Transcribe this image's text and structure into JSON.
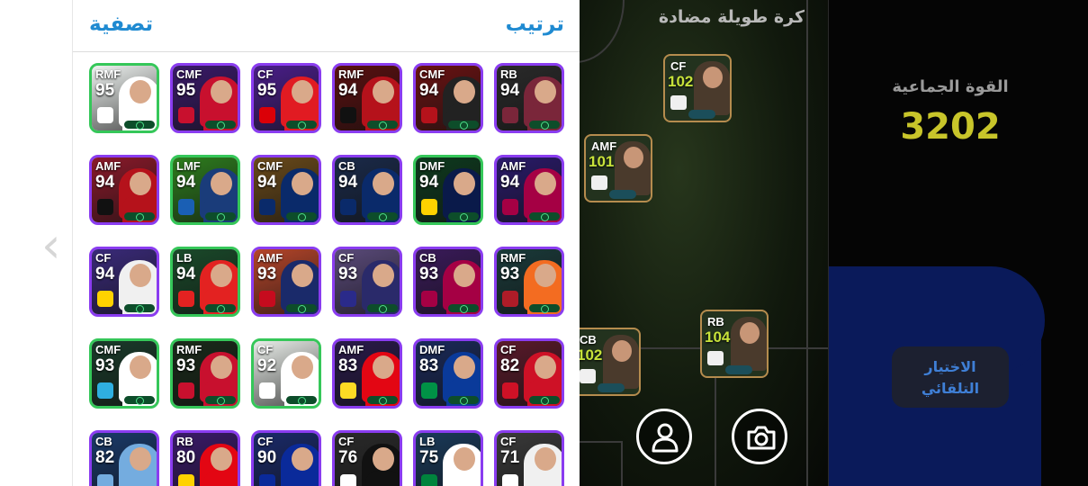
{
  "panel": {
    "filter_label": "تصفية",
    "sort_label": "ترتيب"
  },
  "cards": [
    {
      "pos": "RMF",
      "rating": "95",
      "border": "#35c759",
      "bg": "#eef2f0",
      "kit": "#ffffff",
      "crest": "#ffffff"
    },
    {
      "pos": "CMF",
      "rating": "95",
      "border": "#8a3cf0",
      "bg": "#3a1a6a",
      "kit": "#c8102e",
      "crest": "#c8102e"
    },
    {
      "pos": "CF",
      "rating": "95",
      "border": "#8a3cf0",
      "bg": "#4a1e8a",
      "kit": "#e11b22",
      "crest": "#db0007"
    },
    {
      "pos": "RMF",
      "rating": "94",
      "border": "#8a3cf0",
      "bg": "#5a1010",
      "kit": "#b5121b",
      "crest": "#111111"
    },
    {
      "pos": "CMF",
      "rating": "94",
      "border": "#8a3cf0",
      "bg": "#6a1212",
      "kit": "#222222",
      "crest": "#b5121b"
    },
    {
      "pos": "RB",
      "rating": "94",
      "border": "#8a3cf0",
      "bg": "#2a2a2a",
      "kit": "#7a263a",
      "crest": "#7a263a"
    },
    {
      "pos": "AMF",
      "rating": "94",
      "border": "#8a3cf0",
      "bg": "#8a1a2a",
      "kit": "#b5121b",
      "crest": "#111111"
    },
    {
      "pos": "LMF",
      "rating": "94",
      "border": "#35c759",
      "bg": "#2e7d1e",
      "kit": "#1a3c7a",
      "crest": "#1a5fb4"
    },
    {
      "pos": "CMF",
      "rating": "94",
      "border": "#8a3cf0",
      "bg": "#6a4a1a",
      "kit": "#0a2a6a",
      "crest": "#0a2a6a"
    },
    {
      "pos": "CB",
      "rating": "94",
      "border": "#8a3cf0",
      "bg": "#1a2a4a",
      "kit": "#0a2a6a",
      "crest": "#0a2a6a"
    },
    {
      "pos": "DMF",
      "rating": "94",
      "border": "#35c759",
      "bg": "#0e3a1e",
      "kit": "#0a1a4a",
      "crest": "#ffd200"
    },
    {
      "pos": "AMF",
      "rating": "94",
      "border": "#8a3cf0",
      "bg": "#2a1a6a",
      "kit": "#a50044",
      "crest": "#a50044"
    },
    {
      "pos": "CF",
      "rating": "94",
      "border": "#8a3cf0",
      "bg": "#3a2a7a",
      "kit": "#f0f0f0",
      "crest": "#ffd200"
    },
    {
      "pos": "LB",
      "rating": "94",
      "border": "#35c759",
      "bg": "#1a4a2a",
      "kit": "#e32221",
      "crest": "#e32221"
    },
    {
      "pos": "AMF",
      "rating": "93",
      "border": "#8a3cf0",
      "bg": "#b5452a",
      "kit": "#1a2a6a",
      "crest": "#c60b1e"
    },
    {
      "pos": "CF",
      "rating": "93",
      "border": "#8a3cf0",
      "bg": "#5a4a7a",
      "kit": "#2a2a6a",
      "crest": "#2a2a8a"
    },
    {
      "pos": "CB",
      "rating": "93",
      "border": "#8a3cf0",
      "bg": "#3a1a5a",
      "kit": "#a50044",
      "crest": "#a50044"
    },
    {
      "pos": "RMF",
      "rating": "93",
      "border": "#8a3cf0",
      "bg": "#1a3a3a",
      "kit": "#f36c21",
      "crest": "#ae1c28"
    },
    {
      "pos": "CMF",
      "rating": "93",
      "border": "#35c759",
      "bg": "#1a3a2a",
      "kit": "#ffffff",
      "crest": "#2faee0"
    },
    {
      "pos": "RMF",
      "rating": "93",
      "border": "#35c759",
      "bg": "#1a2a1a",
      "kit": "#c8102e",
      "crest": "#c8102e"
    },
    {
      "pos": "CF",
      "rating": "92",
      "border": "#35c759",
      "bg": "#e8ece8",
      "kit": "#ffffff",
      "crest": "#ffffff"
    },
    {
      "pos": "AMF",
      "rating": "83",
      "border": "#8a3cf0",
      "bg": "#2a1a4a",
      "kit": "#e30613",
      "crest": "#fdda24"
    },
    {
      "pos": "DMF",
      "rating": "83",
      "border": "#8a3cf0",
      "bg": "#1a2a5a",
      "kit": "#0a3a9a",
      "crest": "#009246"
    },
    {
      "pos": "CF",
      "rating": "82",
      "border": "#8a3cf0",
      "bg": "#5a1a2a",
      "kit": "#ce1126",
      "crest": "#ce1126"
    },
    {
      "pos": "CB",
      "rating": "82",
      "border": "#8a3cf0",
      "bg": "#1a3a6a",
      "kit": "#74acdf",
      "crest": "#74acdf"
    },
    {
      "pos": "RB",
      "rating": "80",
      "border": "#8a3cf0",
      "bg": "#3a1a6a",
      "kit": "#e30613",
      "crest": "#ffd200"
    },
    {
      "pos": "CF",
      "rating": "90",
      "border": "#8a3cf0",
      "bg": "#1a2a6a",
      "kit": "#0a2a9a",
      "crest": "#0a2a9a"
    },
    {
      "pos": "CF",
      "rating": "76",
      "border": "#8a3cf0",
      "bg": "#2a2a2a",
      "kit": "#111111",
      "crest": "#ffffff"
    },
    {
      "pos": "LB",
      "rating": "75",
      "border": "#8a3cf0",
      "bg": "#1a3a5a",
      "kit": "#ffffff",
      "crest": "#00843d"
    },
    {
      "pos": "CF",
      "rating": "71",
      "border": "#8a3cf0",
      "bg": "#3a3a3a",
      "kit": "#f0f0f0",
      "crest": "#ffffff"
    }
  ],
  "pitch": {
    "title": "كرة طويلة مضادة",
    "players": [
      {
        "pos": "CF",
        "rating": "102"
      },
      {
        "pos": "AMF",
        "rating": "101"
      },
      {
        "pos": "CB",
        "rating": "102"
      },
      {
        "pos": "RB",
        "rating": "104"
      }
    ]
  },
  "info": {
    "team_strength_label": "القوة الجماعية",
    "team_strength_value": "3202",
    "auto_select_line1": "الاختيار",
    "auto_select_line2": "التلقائي"
  },
  "icons": {
    "back": "chevron-left-icon",
    "profile": "person-icon",
    "camera": "camera-icon"
  },
  "colors": {
    "accent": "#1f8ad1",
    "team_value": "#c8c52a",
    "rating_on_pitch": "#c7e23a"
  }
}
